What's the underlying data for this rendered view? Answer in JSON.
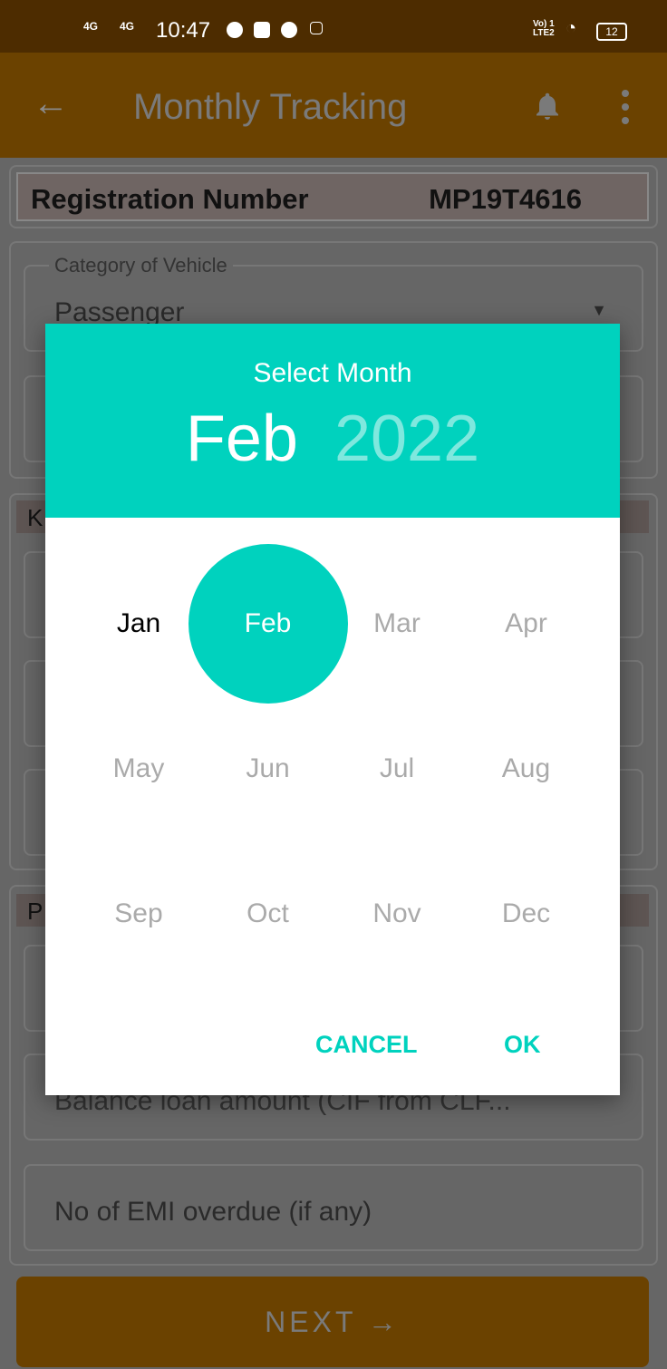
{
  "status_bar": {
    "time": "10:47",
    "signal1": "4G",
    "signal2": "4G",
    "network": "Vo) 1 LTE2",
    "battery": "12"
  },
  "app_bar": {
    "title": "Monthly Tracking",
    "back_icon": "arrow-left-icon",
    "bell_icon": "bell-icon",
    "more_icon": "more-vertical-icon"
  },
  "form": {
    "registration_label": "Registration Number",
    "registration_value": "MP19T4616",
    "category_label": "Category of Vehicle",
    "category_value": "Passenger",
    "section2_header": "K",
    "section3_header": "P",
    "balance_placeholder": "Balance loan amount (CIF from CLF...",
    "emi_placeholder": "No of EMI overdue (if any)",
    "next_label": "NEXT"
  },
  "dialog": {
    "title": "Select Month",
    "selected_month": "Feb",
    "selected_year": "2022",
    "months": [
      "Jan",
      "Feb",
      "Mar",
      "Apr",
      "May",
      "Jun",
      "Jul",
      "Aug",
      "Sep",
      "Oct",
      "Nov",
      "Dec"
    ],
    "cancel": "CANCEL",
    "ok": "OK"
  },
  "colors": {
    "accent": "#00d2be",
    "primary": "#6b4200"
  }
}
